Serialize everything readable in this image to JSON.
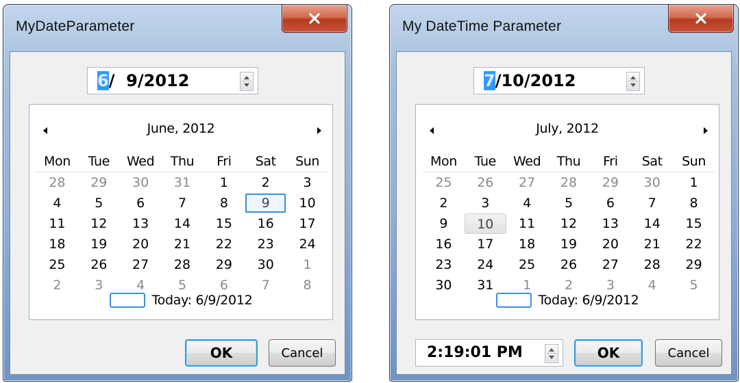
{
  "left_dialog": {
    "title": "MyDateParameter",
    "date_value_selected": "6",
    "date_value_rest": "/  9/2012",
    "calendar": {
      "month_label": "June, 2012",
      "weekdays": [
        "Mon",
        "Tue",
        "Wed",
        "Thu",
        "Fri",
        "Sat",
        "Sun"
      ],
      "weeks": [
        [
          "28",
          "29",
          "30",
          "31",
          "1",
          "2",
          "3"
        ],
        [
          "4",
          "5",
          "6",
          "7",
          "8",
          "9",
          "10"
        ],
        [
          "11",
          "12",
          "13",
          "14",
          "15",
          "16",
          "17"
        ],
        [
          "18",
          "19",
          "20",
          "21",
          "22",
          "23",
          "24"
        ],
        [
          "25",
          "26",
          "27",
          "28",
          "29",
          "30",
          "1"
        ],
        [
          "2",
          "3",
          "4",
          "5",
          "6",
          "7",
          "8"
        ]
      ],
      "selected_day": "9",
      "today_label": "Today: 6/9/2012"
    },
    "ok_label": "OK",
    "cancel_label": "Cancel"
  },
  "right_dialog": {
    "title": "My DateTime Parameter",
    "date_value_selected": "7",
    "date_value_rest": "/10/2012",
    "calendar": {
      "month_label": "July, 2012",
      "weekdays": [
        "Mon",
        "Tue",
        "Wed",
        "Thu",
        "Fri",
        "Sat",
        "Sun"
      ],
      "weeks": [
        [
          "25",
          "26",
          "27",
          "28",
          "29",
          "30",
          "1"
        ],
        [
          "2",
          "3",
          "4",
          "5",
          "6",
          "7",
          "8"
        ],
        [
          "9",
          "10",
          "11",
          "12",
          "13",
          "14",
          "15"
        ],
        [
          "16",
          "17",
          "18",
          "19",
          "20",
          "21",
          "22"
        ],
        [
          "23",
          "24",
          "25",
          "26",
          "27",
          "28",
          "29"
        ],
        [
          "30",
          "31",
          "1",
          "2",
          "3",
          "4",
          "5"
        ]
      ],
      "selected_day": "10",
      "today_label": "Today: 6/9/2012"
    },
    "time_value": "2:19:01 PM",
    "ok_label": "OK",
    "cancel_label": "Cancel"
  },
  "colors": {
    "selection": "#3399ff",
    "focus_blue": "#3d8ee0",
    "close_red": "#c8553a",
    "frame_blue": "#8fb0d8"
  }
}
